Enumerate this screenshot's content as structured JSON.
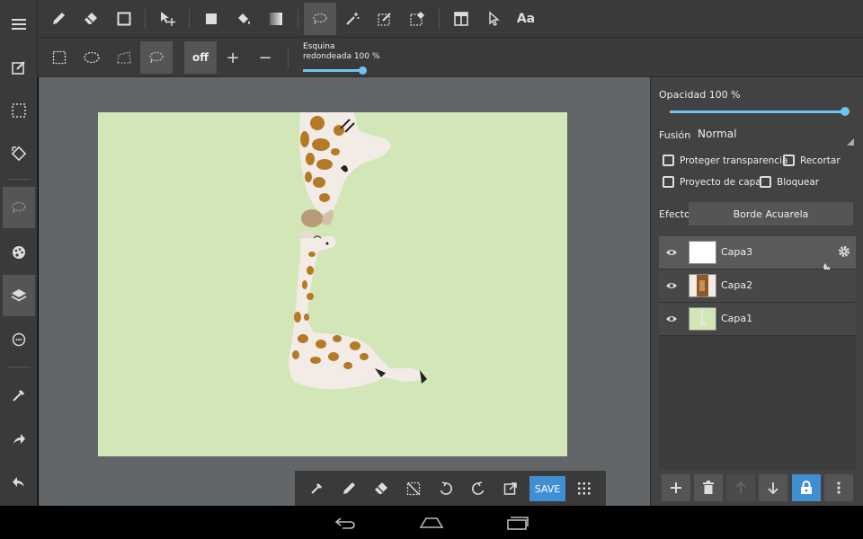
{
  "left_toolbar": {
    "items": [
      {
        "icon": "menu-icon"
      },
      {
        "icon": "edit-canvas-icon"
      },
      {
        "icon": "selection-icon"
      },
      {
        "icon": "transform-icon"
      },
      {
        "icon": "lasso-icon",
        "active": true
      },
      {
        "icon": "palette-icon"
      },
      {
        "icon": "layers-icon",
        "active": true
      },
      {
        "icon": "brush-settings-icon"
      },
      {
        "icon": "eyedropper-icon"
      },
      {
        "icon": "share-icon"
      },
      {
        "icon": "undo-icon"
      }
    ]
  },
  "top_toolbar": {
    "tools": [
      "pen-icon",
      "eraser-icon",
      "square-icon",
      "move-icon",
      "fill-rect-icon",
      "bucket-icon",
      "gradient-icon",
      "lasso-select-icon",
      "magic-wand-icon",
      "select-pen-icon",
      "select-eraser-icon",
      "panel-icon",
      "pointer-icon"
    ],
    "text_tool_label": "Aa"
  },
  "sub_toolbar": {
    "off_label": "off",
    "plus_label": "+",
    "minus_label": "−",
    "corner_label_line1": "Esquina",
    "corner_label_line2": "redondeada 100 %",
    "corner_value_percent": 100
  },
  "bottom_toolbar": {
    "tools": [
      "eyedropper-icon",
      "pen-icon",
      "eraser-icon",
      "deselect-icon",
      "undo-icon",
      "redo-icon",
      "export-icon"
    ],
    "save_label": "SAVE",
    "grid_icon": "grid-icon"
  },
  "layer_panel": {
    "opacity_label": "Opacidad 100 %",
    "opacity_percent": 100,
    "blend_label": "Fusión",
    "blend_value": "Normal",
    "checkboxes": {
      "protect_transparency": "Proteger transparencia",
      "clip": "Recortar",
      "draft_layer": "Proyecto de capa",
      "lock": "Bloquear"
    },
    "effect_label": "Efecto",
    "effect_value": "Borde Acuarela",
    "layers": [
      {
        "name": "Capa3",
        "selected": true
      },
      {
        "name": "Capa2",
        "selected": false
      },
      {
        "name": "Capa1",
        "selected": false
      }
    ]
  },
  "nav_bar": [
    "back-icon",
    "home-icon",
    "recents-icon"
  ],
  "colors": {
    "accent": "#3f8fd2",
    "slider": "#6ec6f0",
    "canvas_bg": "#d2e6b8",
    "toolbar": "#3a3a3a"
  }
}
